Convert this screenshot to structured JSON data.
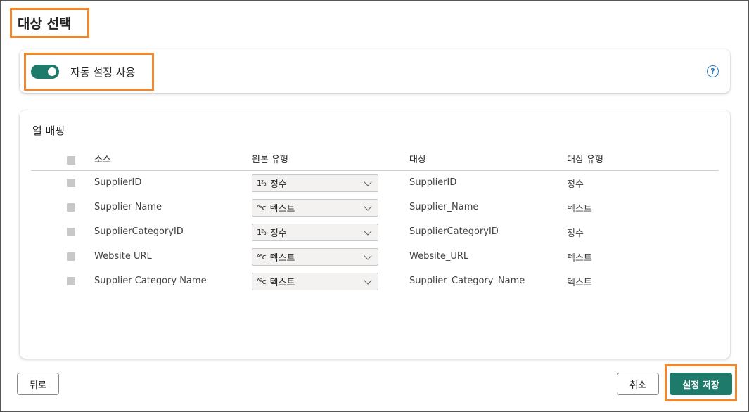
{
  "page": {
    "title": "대상 선택"
  },
  "auto_settings": {
    "label": "자동 설정 사용",
    "enabled": true,
    "help_icon": "question-circle-icon"
  },
  "mapping": {
    "title": "열 매핑",
    "headers": {
      "source": "소스",
      "source_type": "원본 유형",
      "destination": "대상",
      "destination_type": "대상 유형"
    },
    "rows": [
      {
        "source": "SupplierID",
        "type_icon": "123",
        "source_type": "정수",
        "destination": "SupplierID",
        "destination_type": "정수"
      },
      {
        "source": "Supplier Name",
        "type_icon": "ABC",
        "source_type": "텍스트",
        "destination": "Supplier_Name",
        "destination_type": "텍스트"
      },
      {
        "source": "SupplierCategoryID",
        "type_icon": "123",
        "source_type": "정수",
        "destination": "SupplierCategoryID",
        "destination_type": "정수"
      },
      {
        "source": "Website URL",
        "type_icon": "ABC",
        "source_type": "텍스트",
        "destination": "Website_URL",
        "destination_type": "텍스트"
      },
      {
        "source": "Supplier Category Name",
        "type_icon": "ABC",
        "source_type": "텍스트",
        "destination": "Supplier_Category_Name",
        "destination_type": "텍스트"
      }
    ]
  },
  "footer": {
    "back_label": "뒤로",
    "cancel_label": "취소",
    "save_label": "설정 저장"
  },
  "colors": {
    "accent": "#1e7a6a",
    "highlight": "#f0862d",
    "help": "#2b7bbf"
  }
}
